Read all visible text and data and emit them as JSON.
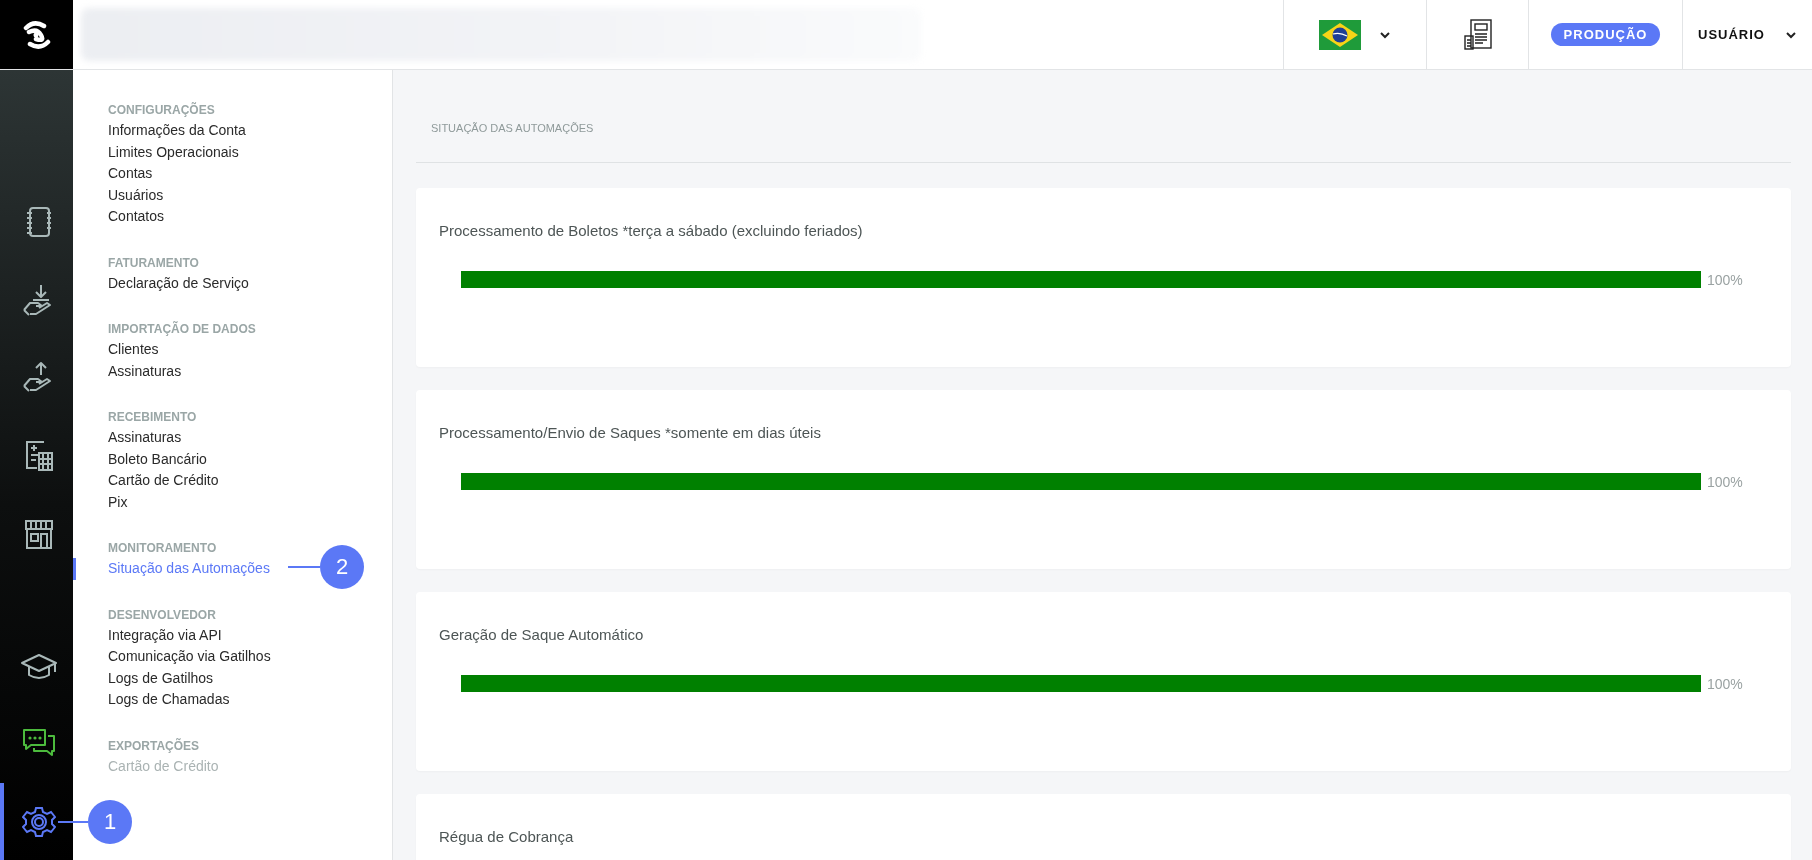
{
  "topbar": {
    "environment_badge": "PRODUÇÃO",
    "user_menu": "USUÁRIO"
  },
  "rail": [
    {
      "selected": false
    },
    {
      "selected": false
    },
    {
      "selected": false
    },
    {
      "selected": false
    },
    {
      "selected": false
    },
    {
      "selected": false
    },
    {
      "selected": false
    },
    {
      "selected": true
    }
  ],
  "menu": [
    {
      "heading": "CONFIGURAÇÕES",
      "items": [
        {
          "label": "Informações da Conta",
          "selected": false,
          "disabled": false
        },
        {
          "label": "Limites Operacionais",
          "selected": false,
          "disabled": false
        },
        {
          "label": "Contas",
          "selected": false,
          "disabled": false
        },
        {
          "label": "Usuários",
          "selected": false,
          "disabled": false
        },
        {
          "label": "Contatos",
          "selected": false,
          "disabled": false
        }
      ]
    },
    {
      "heading": "FATURAMENTO",
      "items": [
        {
          "label": "Declaração de Serviço",
          "selected": false,
          "disabled": false
        }
      ]
    },
    {
      "heading": "IMPORTAÇÃO DE DADOS",
      "items": [
        {
          "label": "Clientes",
          "selected": false,
          "disabled": false
        },
        {
          "label": "Assinaturas",
          "selected": false,
          "disabled": false
        }
      ]
    },
    {
      "heading": "RECEBIMENTO",
      "items": [
        {
          "label": "Assinaturas",
          "selected": false,
          "disabled": false
        },
        {
          "label": "Boleto Bancário",
          "selected": false,
          "disabled": false
        },
        {
          "label": "Cartão de Crédito",
          "selected": false,
          "disabled": false
        },
        {
          "label": "Pix",
          "selected": false,
          "disabled": false
        }
      ]
    },
    {
      "heading": "MONITORAMENTO",
      "items": [
        {
          "label": "Situação das Automações",
          "selected": true,
          "disabled": false
        }
      ]
    },
    {
      "heading": "DESENVOLVEDOR",
      "items": [
        {
          "label": "Integração via API",
          "selected": false,
          "disabled": false
        },
        {
          "label": "Comunicação via Gatilhos",
          "selected": false,
          "disabled": false
        },
        {
          "label": "Logs de Gatilhos",
          "selected": false,
          "disabled": false
        },
        {
          "label": "Logs de Chamadas",
          "selected": false,
          "disabled": false
        }
      ]
    },
    {
      "heading": "EXPORTAÇÕES",
      "items": [
        {
          "label": "Cartão de Crédito",
          "selected": false,
          "disabled": true
        }
      ]
    }
  ],
  "page_title": "SITUAÇÃO DAS AUTOMAÇÕES",
  "automations": [
    {
      "title": "Processamento de Boletos *terça a sábado (excluindo feriados)",
      "level": 1,
      "reading": "100%"
    },
    {
      "title": "Processamento/Envio de Saques *somente em dias úteis",
      "level": 1,
      "reading": "100%"
    },
    {
      "title": "Geração de Saque Automático",
      "level": 1,
      "reading": "100%"
    },
    {
      "title": "Régua de Cobrança"
    }
  ],
  "annotations": [
    {
      "label": "1"
    },
    {
      "label": "2"
    }
  ]
}
